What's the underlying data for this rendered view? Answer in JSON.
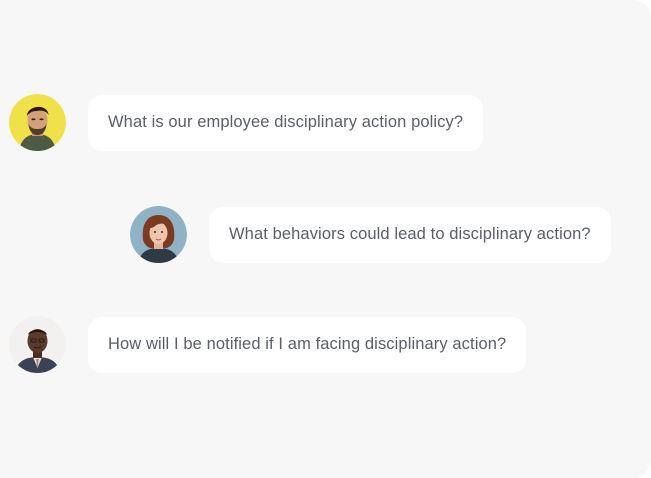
{
  "chat": {
    "messages": [
      {
        "text": "What is our employee disciplinary action policy?",
        "avatar_icon": "avatar-man-yellow-bg-icon",
        "avatar_bg": "#f0e14a"
      },
      {
        "text": "What behaviors could lead to disciplinary action?",
        "avatar_icon": "avatar-woman-redhair-icon",
        "avatar_bg": "#8fb3c4"
      },
      {
        "text": "How will I be notified if I am facing disciplinary action?",
        "avatar_icon": "avatar-man-suit-icon",
        "avatar_bg": "#f3f1ef"
      }
    ]
  },
  "colors": {
    "background": "#f7f7f7",
    "bubble": "#ffffff",
    "text": "#5b5e68"
  }
}
